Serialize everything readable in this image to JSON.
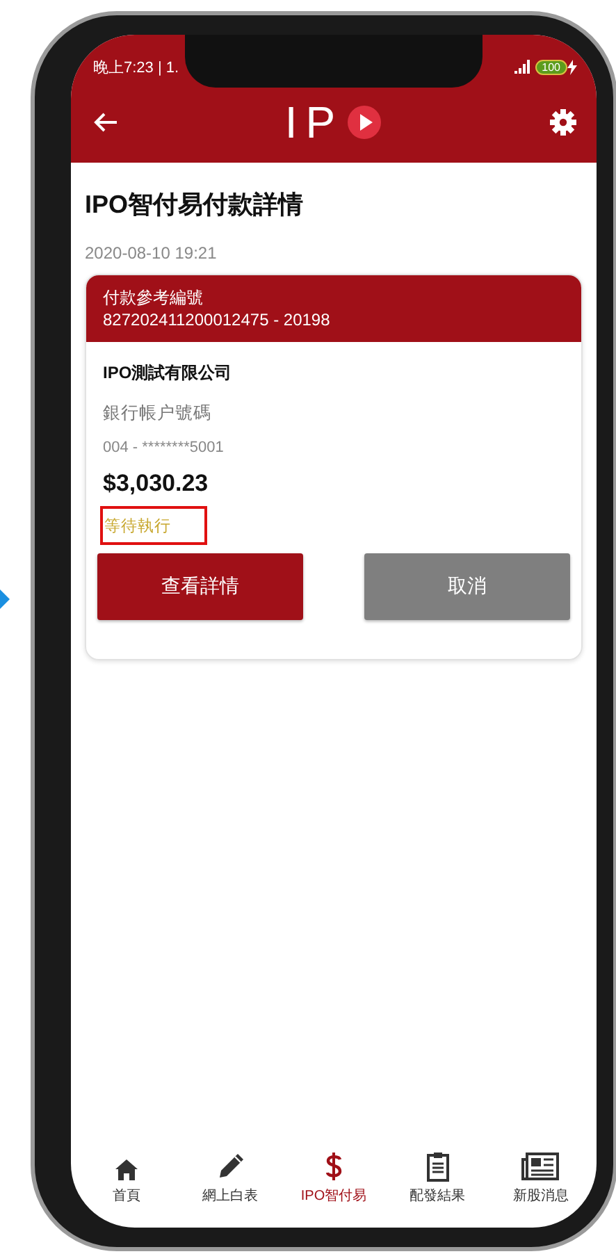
{
  "status_bar": {
    "time": "晚上7:23 | 1.",
    "battery": "100"
  },
  "app_bar": {
    "logo": "IP"
  },
  "page": {
    "title": "IPO智付易付款詳情",
    "date": "2020-08-10 19:21"
  },
  "payment_card": {
    "header_label": "付款參考編號",
    "reference": "827202411200012475 - 20198",
    "company": "IPO測試有限公司",
    "account_label": "銀行帳户號碼",
    "account": "004 - ********5001",
    "amount": "$3,030.23",
    "status": "等待執行",
    "status_highlighted": true,
    "buttons": [
      {
        "label": "查看詳情",
        "kind": "primary"
      },
      {
        "label": "取消",
        "kind": "secondary"
      }
    ]
  },
  "tab_bar": [
    {
      "label": "首頁",
      "selected": false
    },
    {
      "label": "網上白表",
      "selected": false
    },
    {
      "label": "IPO智付易",
      "selected": true
    },
    {
      "label": "配發結果",
      "selected": false
    },
    {
      "label": "新股消息",
      "selected": false
    }
  ]
}
